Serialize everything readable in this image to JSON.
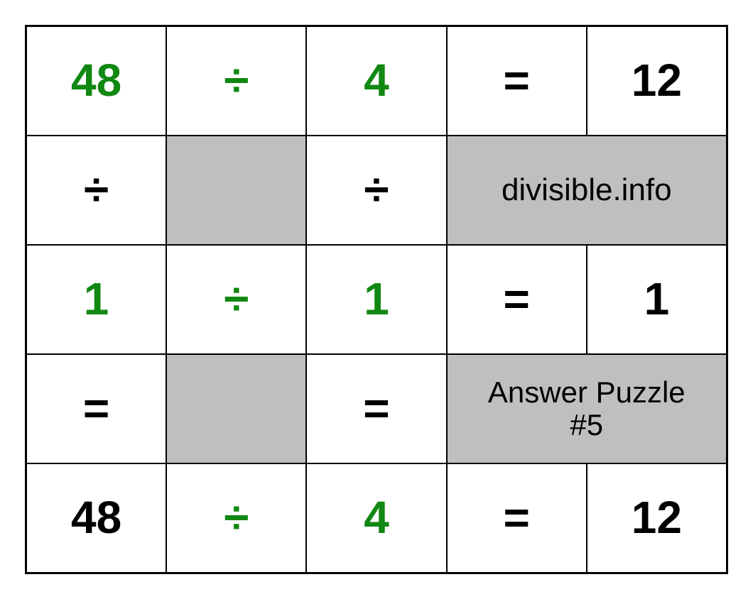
{
  "grid": {
    "r1c1": "48",
    "r1c2": "÷",
    "r1c3": "4",
    "r1c4": "=",
    "r1c5": "12",
    "r2c1": "÷",
    "r2c2": "",
    "r2c3": "÷",
    "r2_info": "divisible.info",
    "r3c1": "1",
    "r3c2": "÷",
    "r3c3": "1",
    "r3c4": "=",
    "r3c5": "1",
    "r4c1": "=",
    "r4c2": "",
    "r4c3": "=",
    "r4_info_line1": "Answer Puzzle",
    "r4_info_line2": "#5",
    "r5c1": "48",
    "r5c2": "÷",
    "r5c3": "4",
    "r5c4": "=",
    "r5c5": "12"
  },
  "colors": {
    "green": "#118811",
    "shaded": "#bfbfbf"
  }
}
